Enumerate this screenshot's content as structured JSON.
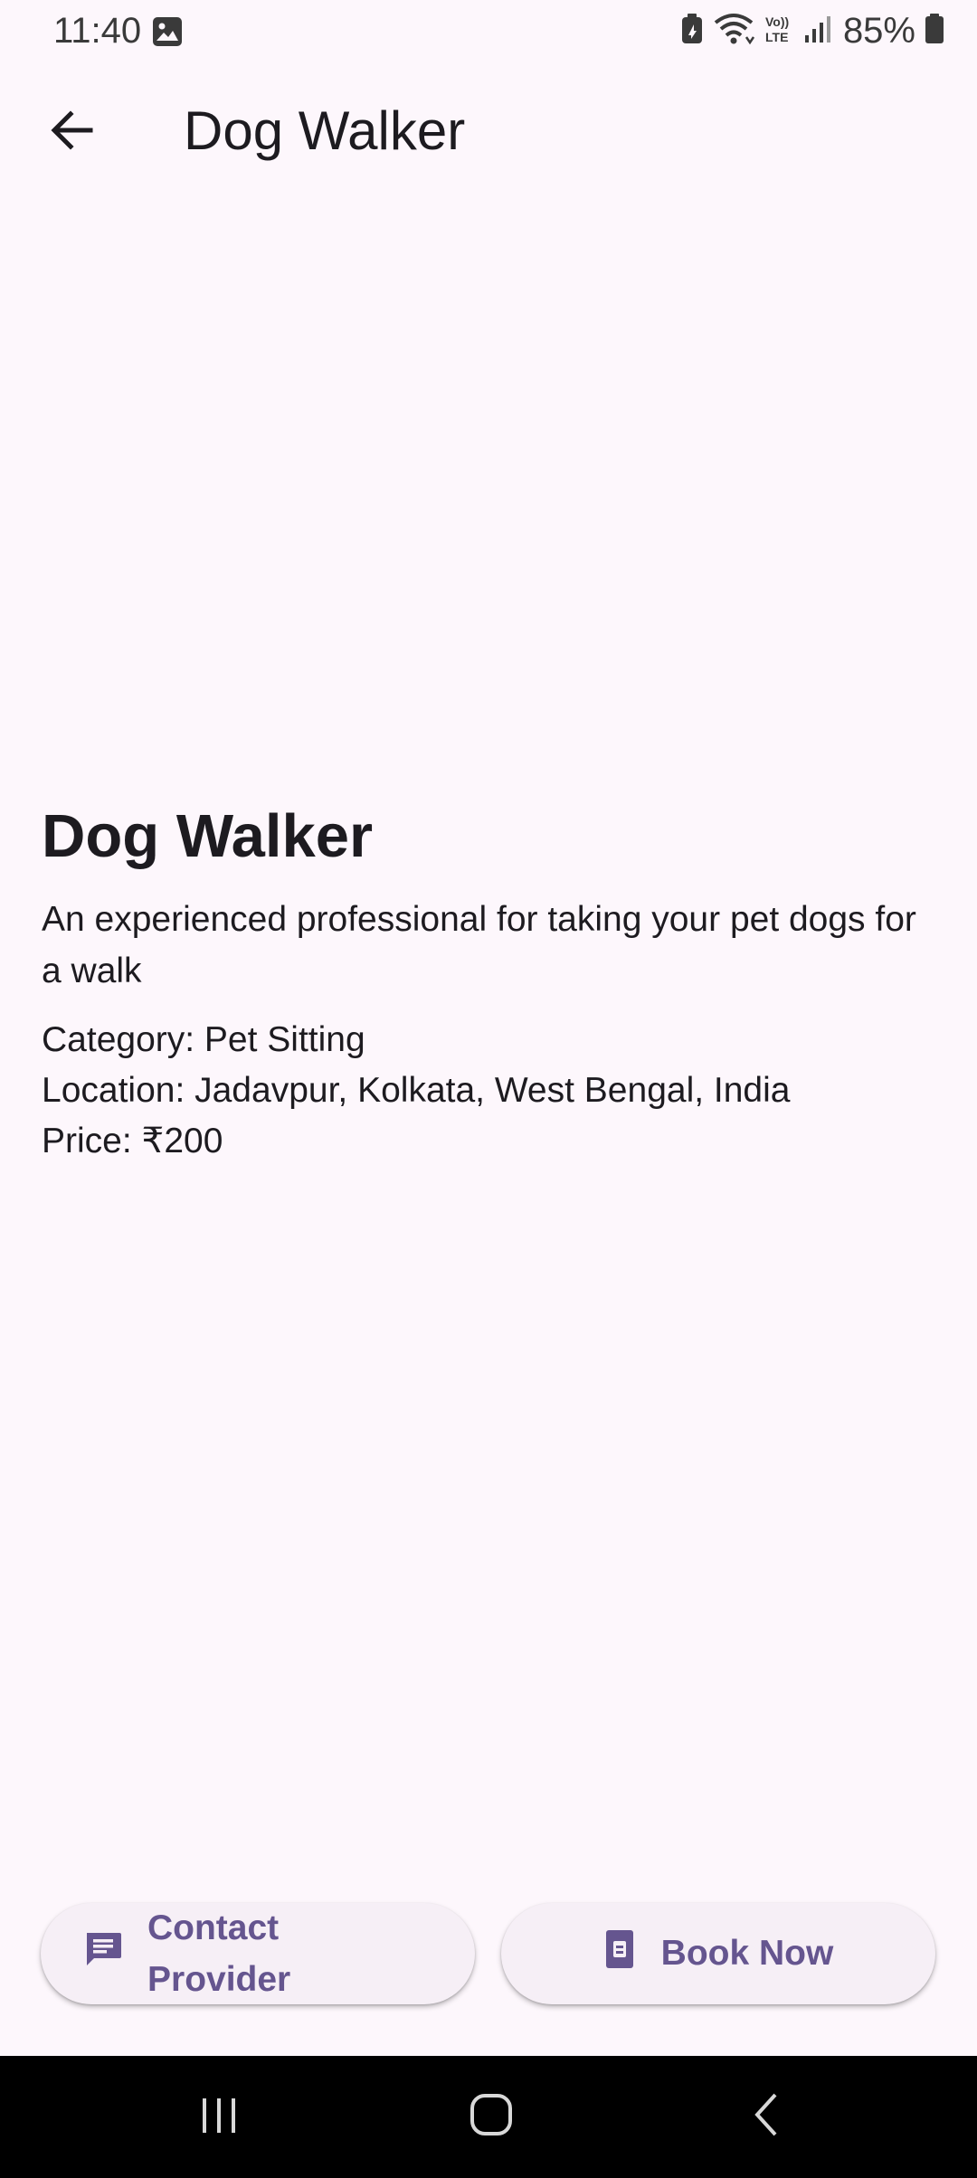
{
  "status_bar": {
    "time": "11:40",
    "battery": "85%",
    "icons": [
      "image-icon",
      "battery-saver-icon",
      "wifi-icon",
      "volte-icon",
      "signal-icon",
      "battery-icon"
    ]
  },
  "app_bar": {
    "title": "Dog Walker",
    "back_icon": "arrow-back-icon"
  },
  "service": {
    "title": "Dog Walker",
    "description": "An experienced professional for taking your pet dogs for a walk",
    "category": "Category: Pet Sitting",
    "location": "Location: Jadavpur, Kolkata, West Bengal, India",
    "price": "Price: ₹200"
  },
  "actions": {
    "contact_line1": "Contact",
    "contact_line2": "Provider",
    "contact_icon": "chat-icon",
    "book_label": "Book Now",
    "book_icon": "book-icon"
  },
  "nav_bar": {
    "icons": [
      "recents-icon",
      "home-icon",
      "back-icon"
    ]
  },
  "colors": {
    "background": "#fdf7fc",
    "accent": "#65558f",
    "button_bg": "#f6eff6"
  }
}
